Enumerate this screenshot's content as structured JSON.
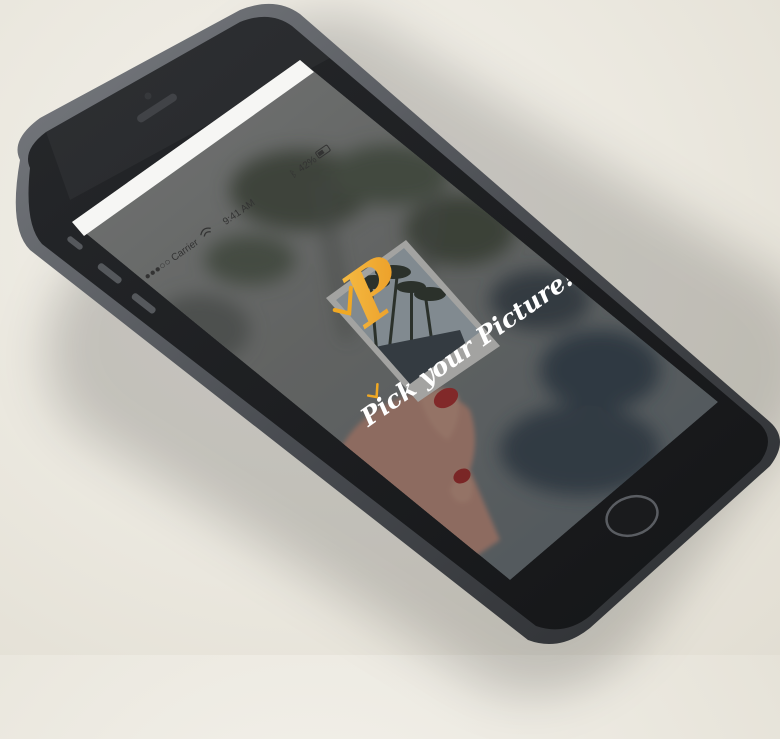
{
  "status_bar": {
    "carrier": "●●●○○ Carrier",
    "time": "9:41 AM",
    "bluetooth_icon": "bluetooth-icon",
    "battery": "42%"
  },
  "splash": {
    "logo_letter": "P",
    "tagline": "Pick your Picture!"
  },
  "colors": {
    "brand_orange": "#f0a823",
    "phone_body": "#1c1d1f",
    "phone_frame": "#5a5d62",
    "screen_overlay": "#3b3b3b"
  }
}
